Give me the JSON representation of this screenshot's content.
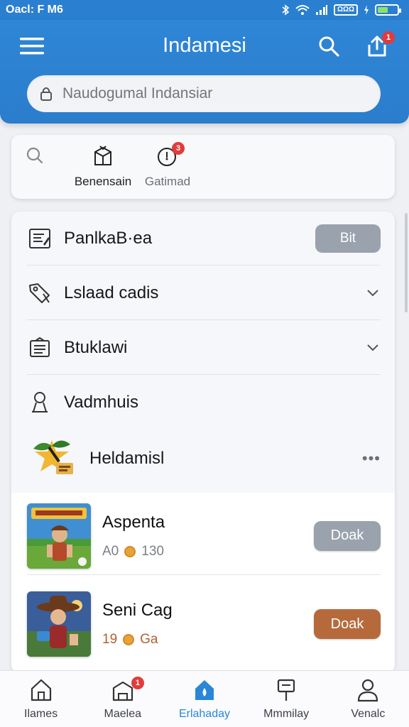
{
  "status_bar": {
    "time": "Oacl: F M6",
    "carrier_badge": "ΩΩΩ",
    "battery_level": 0.55
  },
  "header": {
    "title": "Indamesi",
    "share_badge": "1",
    "search_placeholder": "Naudogumal Indansiar"
  },
  "quick_actions": [
    {
      "label": "Benensain",
      "icon": "box-icon"
    },
    {
      "label": "Gatimad",
      "icon": "timer-icon",
      "badge": "3"
    }
  ],
  "menu": {
    "rows": [
      {
        "label": "PanlkaB·ea",
        "icon": "document-icon",
        "action": "Bit"
      },
      {
        "label": "Lslaad cadis",
        "icon": "tag-icon"
      },
      {
        "label": "Btuklawi",
        "icon": "newspaper-icon"
      },
      {
        "label": "Vadmhuis",
        "icon": "person-icon"
      },
      {
        "label": "Heldamisl",
        "icon": "game-logo-icon"
      }
    ]
  },
  "games": [
    {
      "title": "Aspenta",
      "meta_left": "A0",
      "meta_right": "130",
      "button": "Doak",
      "button_color": "#9aa2ad"
    },
    {
      "title": "Seni Cag",
      "meta_left": "19",
      "meta_right": "Ga",
      "button": "Doak",
      "button_color": "#b66a3c"
    }
  ],
  "bottom_nav": [
    {
      "label": "Ilames",
      "icon": "home-icon",
      "active": false
    },
    {
      "label": "Maelea",
      "icon": "box-icon",
      "badge": "1",
      "active": false
    },
    {
      "label": "Erlahaday",
      "icon": "house-drop-icon",
      "active": true
    },
    {
      "label": "Mmmilay",
      "icon": "signpost-icon",
      "active": false
    },
    {
      "label": "Venalc",
      "icon": "person-icon",
      "active": false
    }
  ],
  "colors": {
    "header_blue": "#2a7fd0",
    "active_blue": "#2a86d6",
    "badge_red": "#e23b3b",
    "button_gray": "#9aa2ad",
    "button_orange": "#b66a3c"
  }
}
